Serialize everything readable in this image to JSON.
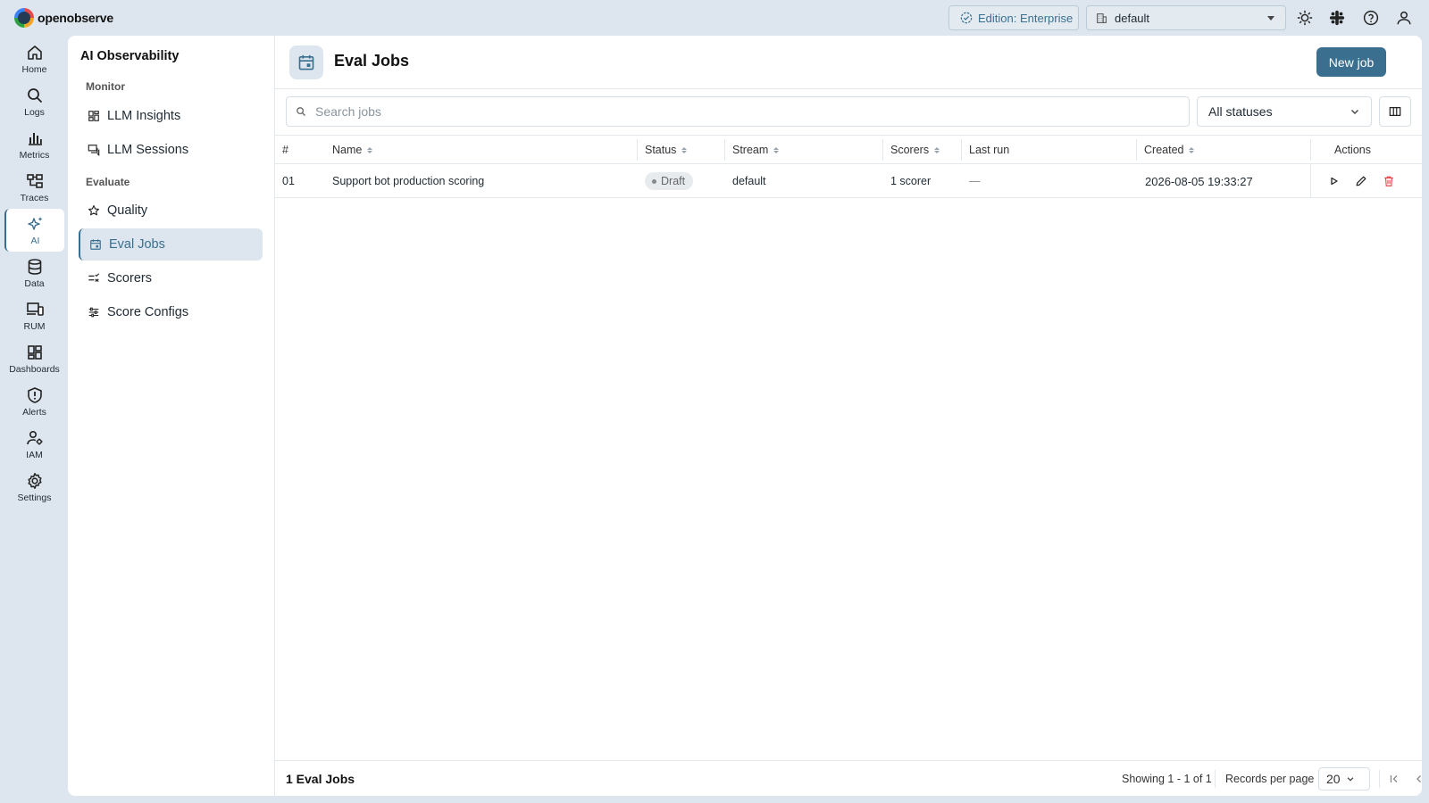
{
  "app": {
    "name": "openobserve"
  },
  "topbar": {
    "edition_label": "Edition: Enterprise",
    "org_selected": "default",
    "icons": [
      "theme-toggle-icon",
      "slack-icon",
      "help-icon",
      "user-icon"
    ]
  },
  "leftnav": {
    "items": [
      {
        "label": "Home",
        "icon": "home-icon"
      },
      {
        "label": "Logs",
        "icon": "search-icon"
      },
      {
        "label": "Metrics",
        "icon": "bar-chart-icon"
      },
      {
        "label": "Traces",
        "icon": "traces-icon"
      },
      {
        "label": "AI",
        "icon": "sparkle-icon",
        "active": true
      },
      {
        "label": "Data",
        "icon": "database-icon"
      },
      {
        "label": "RUM",
        "icon": "devices-icon"
      },
      {
        "label": "Dashboards",
        "icon": "dashboard-icon"
      },
      {
        "label": "Alerts",
        "icon": "shield-alert-icon"
      },
      {
        "label": "IAM",
        "icon": "iam-icon"
      },
      {
        "label": "Settings",
        "icon": "gear-icon"
      }
    ]
  },
  "subnav": {
    "title": "AI Observability",
    "sections": {
      "monitor": "Monitor",
      "evaluate": "Evaluate"
    },
    "items": {
      "llm_insights": "LLM Insights",
      "llm_sessions": "LLM Sessions",
      "quality": "Quality",
      "eval_jobs": "Eval Jobs",
      "scorers": "Scorers",
      "score_configs": "Score Configs"
    }
  },
  "page": {
    "title": "Eval Jobs",
    "new_job_label": "New job",
    "search_placeholder": "Search jobs",
    "status_filter": "All statuses"
  },
  "table": {
    "headers": {
      "num": "#",
      "name": "Name",
      "status": "Status",
      "stream": "Stream",
      "scorers": "Scorers",
      "last_run": "Last run",
      "created": "Created",
      "actions": "Actions"
    },
    "rows": [
      {
        "num": "01",
        "name": "Support bot production scoring",
        "status": "Draft",
        "stream": "default",
        "scorers": "1 scorer",
        "last_run": "—",
        "created": "2026-08-05 19:33:27"
      }
    ]
  },
  "footer": {
    "count_label": "1 Eval Jobs",
    "showing": "Showing 1 - 1 of 1",
    "records_per_page_label": "Records per page",
    "records_per_page": "20"
  },
  "colors": {
    "accent": "#3b6f8f",
    "background": "#dde6ee",
    "delete": "#e5484d"
  }
}
